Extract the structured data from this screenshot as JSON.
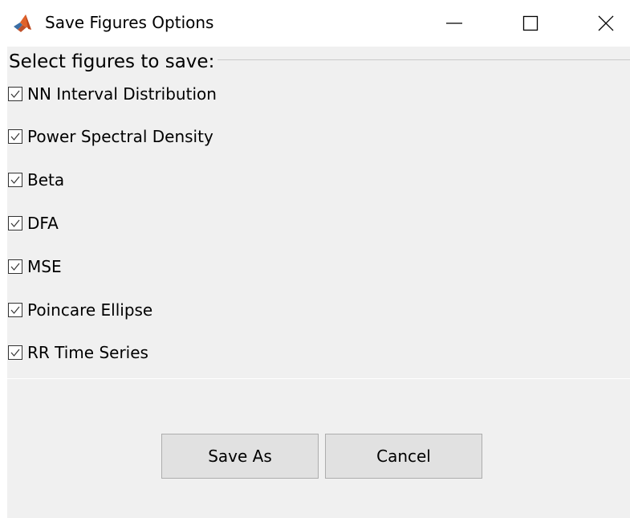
{
  "window": {
    "title": "Save Figures Options",
    "icon": "matlab-icon"
  },
  "panel": {
    "title": "Select figures to save:"
  },
  "figures": [
    {
      "label": "NN Interval Distribution",
      "checked": true
    },
    {
      "label": "Power Spectral Density",
      "checked": true
    },
    {
      "label": "Beta",
      "checked": true
    },
    {
      "label": "DFA",
      "checked": true
    },
    {
      "label": "MSE",
      "checked": true
    },
    {
      "label": "Poincare Ellipse",
      "checked": true
    },
    {
      "label": "RR Time Series",
      "checked": true
    }
  ],
  "buttons": {
    "save_as": "Save As",
    "cancel": "Cancel"
  },
  "colors": {
    "panel_bg": "#f0f0f0",
    "button_bg": "#e1e1e1",
    "button_border": "#adadad"
  }
}
